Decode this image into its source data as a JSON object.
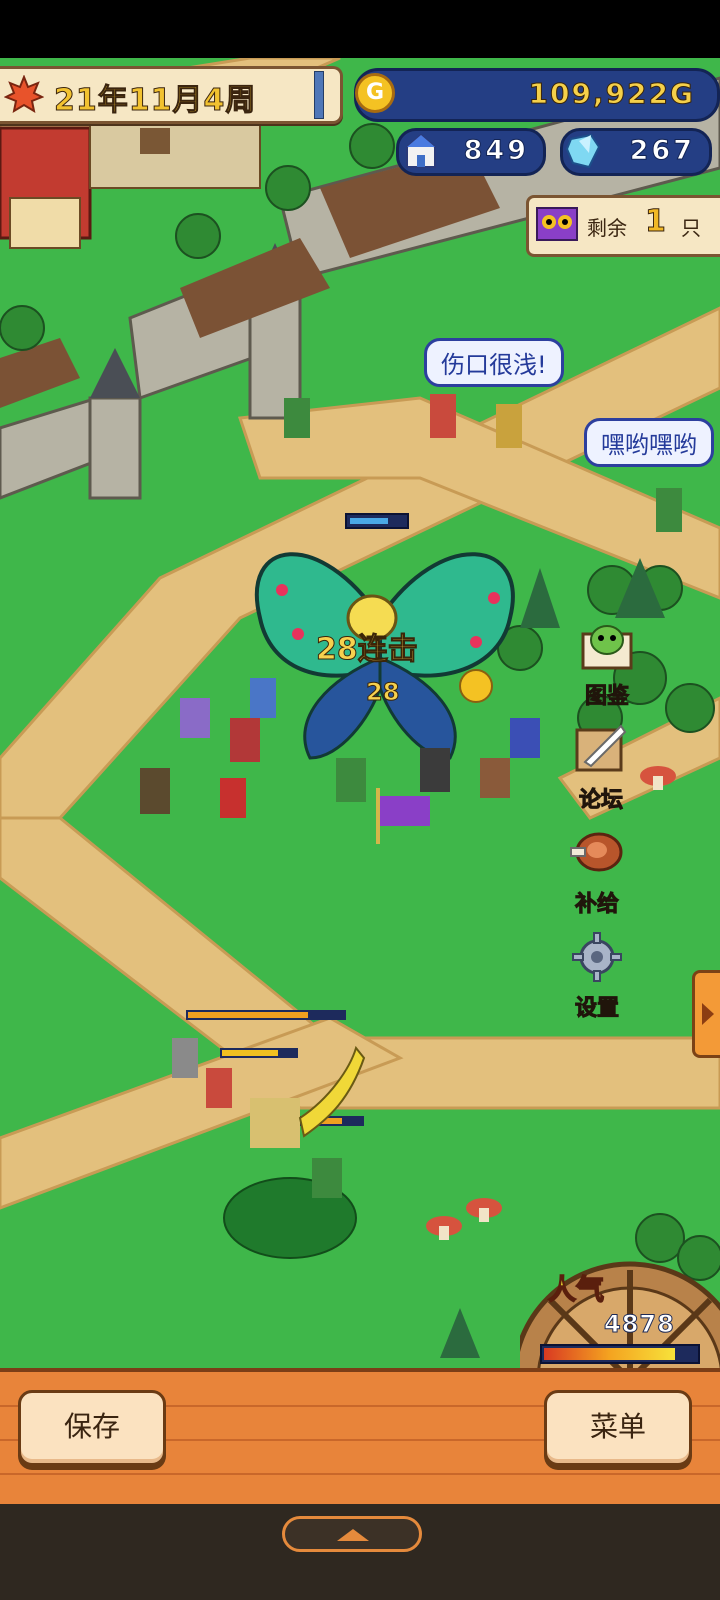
{
  "hud": {
    "date": "21年11月4周",
    "gold": "109,922",
    "gold_unit": "G",
    "coin_letter": "G",
    "population": "849",
    "gems": "267",
    "monsters_remaining_label": "剩余",
    "monsters_remaining_count": "1",
    "monsters_remaining_unit": "只"
  },
  "speech": {
    "bubble1": "伤口很浅!",
    "bubble2": "嘿哟嘿哟"
  },
  "combat": {
    "combo_text": "28连击",
    "combo_number": "28"
  },
  "side_menu": {
    "encyclopedia": "图鉴",
    "forum": "论坛",
    "supply": "补给",
    "settings": "设置"
  },
  "popularity": {
    "label": "人气",
    "value": "4878",
    "level_fraction": 0.86
  },
  "bottom": {
    "save_label": "保存",
    "menu_label": "菜单"
  },
  "colors": {
    "grass": "#3fb74a",
    "path": "#e3c07d",
    "hud_blue": "#243e84",
    "bottom_bar": "#e8843a"
  }
}
